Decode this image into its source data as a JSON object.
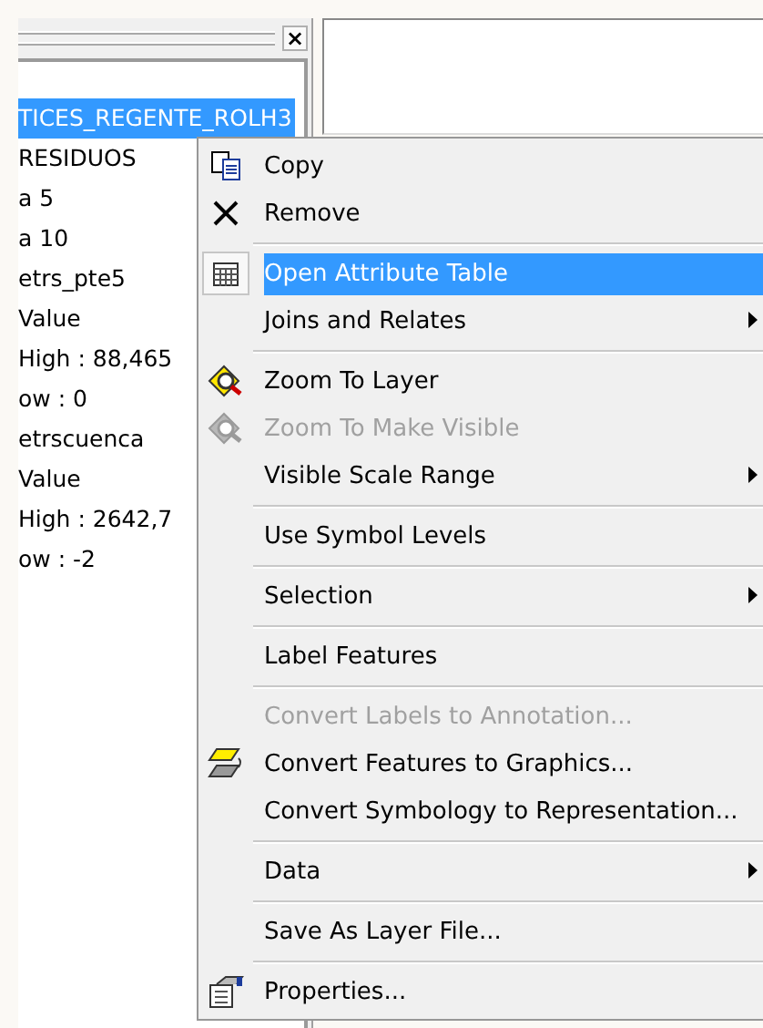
{
  "toc_panel": {
    "close_label": "×",
    "layers": [
      {
        "label": "TICES_REGENTE_ROLH3",
        "selected": true
      },
      {
        "label": "RESIDUOS",
        "selected": false
      },
      {
        "label": "a 5",
        "selected": false
      },
      {
        "label": "a 10",
        "selected": false
      },
      {
        "label": "etrs_pte5",
        "selected": false
      },
      {
        "label": "Value",
        "selected": false
      },
      {
        "label": "High : 88,465",
        "selected": false
      },
      {
        "label": "ow : 0",
        "selected": false
      },
      {
        "label": "etrscuenca",
        "selected": false
      },
      {
        "label": "Value",
        "selected": false
      },
      {
        "label": "High : 2642,7",
        "selected": false
      },
      {
        "label": "ow : -2",
        "selected": false
      }
    ]
  },
  "context_menu": {
    "items": [
      {
        "kind": "item",
        "label": "Copy",
        "disabled": false,
        "selected": false,
        "submenu": false
      },
      {
        "kind": "item",
        "label": "Remove",
        "disabled": false,
        "selected": false,
        "submenu": false
      },
      {
        "kind": "separator"
      },
      {
        "kind": "item",
        "label": "Open Attribute Table",
        "disabled": false,
        "selected": true,
        "submenu": false
      },
      {
        "kind": "item",
        "label": "Joins and Relates",
        "disabled": false,
        "selected": false,
        "submenu": true
      },
      {
        "kind": "separator"
      },
      {
        "kind": "item",
        "label": "Zoom To Layer",
        "disabled": false,
        "selected": false,
        "submenu": false
      },
      {
        "kind": "item",
        "label": "Zoom To Make Visible",
        "disabled": true,
        "selected": false,
        "submenu": false
      },
      {
        "kind": "item",
        "label": "Visible Scale Range",
        "disabled": false,
        "selected": false,
        "submenu": true
      },
      {
        "kind": "separator"
      },
      {
        "kind": "item",
        "label": "Use Symbol Levels",
        "disabled": false,
        "selected": false,
        "submenu": false
      },
      {
        "kind": "separator"
      },
      {
        "kind": "item",
        "label": "Selection",
        "disabled": false,
        "selected": false,
        "submenu": true
      },
      {
        "kind": "separator"
      },
      {
        "kind": "item",
        "label": "Label Features",
        "disabled": false,
        "selected": false,
        "submenu": false
      },
      {
        "kind": "separator"
      },
      {
        "kind": "item",
        "label": "Convert Labels to Annotation...",
        "disabled": true,
        "selected": false,
        "submenu": false
      },
      {
        "kind": "item",
        "label": "Convert Features to Graphics...",
        "disabled": false,
        "selected": false,
        "submenu": false
      },
      {
        "kind": "item",
        "label": "Convert Symbology to Representation...",
        "disabled": false,
        "selected": false,
        "submenu": false
      },
      {
        "kind": "separator"
      },
      {
        "kind": "item",
        "label": "Data",
        "disabled": false,
        "selected": false,
        "submenu": true
      },
      {
        "kind": "separator"
      },
      {
        "kind": "item",
        "label": "Save As Layer File...",
        "disabled": false,
        "selected": false,
        "submenu": false
      },
      {
        "kind": "separator"
      },
      {
        "kind": "item",
        "label": "Properties...",
        "disabled": false,
        "selected": false,
        "submenu": false
      }
    ]
  }
}
